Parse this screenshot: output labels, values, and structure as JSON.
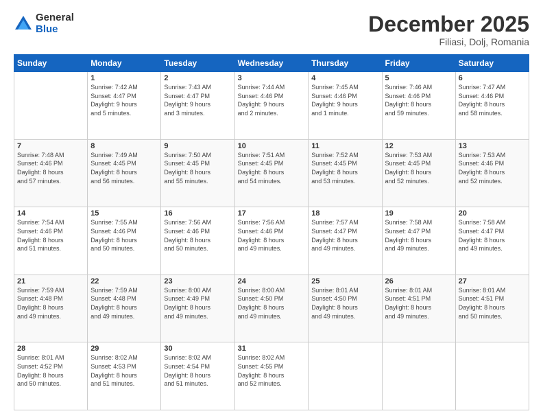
{
  "header": {
    "logo_general": "General",
    "logo_blue": "Blue",
    "month_title": "December 2025",
    "subtitle": "Filiasi, Dolj, Romania"
  },
  "days_of_week": [
    "Sunday",
    "Monday",
    "Tuesday",
    "Wednesday",
    "Thursday",
    "Friday",
    "Saturday"
  ],
  "weeks": [
    [
      {
        "day": "",
        "info": ""
      },
      {
        "day": "1",
        "info": "Sunrise: 7:42 AM\nSunset: 4:47 PM\nDaylight: 9 hours\nand 5 minutes."
      },
      {
        "day": "2",
        "info": "Sunrise: 7:43 AM\nSunset: 4:47 PM\nDaylight: 9 hours\nand 3 minutes."
      },
      {
        "day": "3",
        "info": "Sunrise: 7:44 AM\nSunset: 4:46 PM\nDaylight: 9 hours\nand 2 minutes."
      },
      {
        "day": "4",
        "info": "Sunrise: 7:45 AM\nSunset: 4:46 PM\nDaylight: 9 hours\nand 1 minute."
      },
      {
        "day": "5",
        "info": "Sunrise: 7:46 AM\nSunset: 4:46 PM\nDaylight: 8 hours\nand 59 minutes."
      },
      {
        "day": "6",
        "info": "Sunrise: 7:47 AM\nSunset: 4:46 PM\nDaylight: 8 hours\nand 58 minutes."
      }
    ],
    [
      {
        "day": "7",
        "info": "Sunrise: 7:48 AM\nSunset: 4:46 PM\nDaylight: 8 hours\nand 57 minutes."
      },
      {
        "day": "8",
        "info": "Sunrise: 7:49 AM\nSunset: 4:45 PM\nDaylight: 8 hours\nand 56 minutes."
      },
      {
        "day": "9",
        "info": "Sunrise: 7:50 AM\nSunset: 4:45 PM\nDaylight: 8 hours\nand 55 minutes."
      },
      {
        "day": "10",
        "info": "Sunrise: 7:51 AM\nSunset: 4:45 PM\nDaylight: 8 hours\nand 54 minutes."
      },
      {
        "day": "11",
        "info": "Sunrise: 7:52 AM\nSunset: 4:45 PM\nDaylight: 8 hours\nand 53 minutes."
      },
      {
        "day": "12",
        "info": "Sunrise: 7:53 AM\nSunset: 4:45 PM\nDaylight: 8 hours\nand 52 minutes."
      },
      {
        "day": "13",
        "info": "Sunrise: 7:53 AM\nSunset: 4:46 PM\nDaylight: 8 hours\nand 52 minutes."
      }
    ],
    [
      {
        "day": "14",
        "info": "Sunrise: 7:54 AM\nSunset: 4:46 PM\nDaylight: 8 hours\nand 51 minutes."
      },
      {
        "day": "15",
        "info": "Sunrise: 7:55 AM\nSunset: 4:46 PM\nDaylight: 8 hours\nand 50 minutes."
      },
      {
        "day": "16",
        "info": "Sunrise: 7:56 AM\nSunset: 4:46 PM\nDaylight: 8 hours\nand 50 minutes."
      },
      {
        "day": "17",
        "info": "Sunrise: 7:56 AM\nSunset: 4:46 PM\nDaylight: 8 hours\nand 49 minutes."
      },
      {
        "day": "18",
        "info": "Sunrise: 7:57 AM\nSunset: 4:47 PM\nDaylight: 8 hours\nand 49 minutes."
      },
      {
        "day": "19",
        "info": "Sunrise: 7:58 AM\nSunset: 4:47 PM\nDaylight: 8 hours\nand 49 minutes."
      },
      {
        "day": "20",
        "info": "Sunrise: 7:58 AM\nSunset: 4:47 PM\nDaylight: 8 hours\nand 49 minutes."
      }
    ],
    [
      {
        "day": "21",
        "info": "Sunrise: 7:59 AM\nSunset: 4:48 PM\nDaylight: 8 hours\nand 49 minutes."
      },
      {
        "day": "22",
        "info": "Sunrise: 7:59 AM\nSunset: 4:48 PM\nDaylight: 8 hours\nand 49 minutes."
      },
      {
        "day": "23",
        "info": "Sunrise: 8:00 AM\nSunset: 4:49 PM\nDaylight: 8 hours\nand 49 minutes."
      },
      {
        "day": "24",
        "info": "Sunrise: 8:00 AM\nSunset: 4:50 PM\nDaylight: 8 hours\nand 49 minutes."
      },
      {
        "day": "25",
        "info": "Sunrise: 8:01 AM\nSunset: 4:50 PM\nDaylight: 8 hours\nand 49 minutes."
      },
      {
        "day": "26",
        "info": "Sunrise: 8:01 AM\nSunset: 4:51 PM\nDaylight: 8 hours\nand 49 minutes."
      },
      {
        "day": "27",
        "info": "Sunrise: 8:01 AM\nSunset: 4:51 PM\nDaylight: 8 hours\nand 50 minutes."
      }
    ],
    [
      {
        "day": "28",
        "info": "Sunrise: 8:01 AM\nSunset: 4:52 PM\nDaylight: 8 hours\nand 50 minutes."
      },
      {
        "day": "29",
        "info": "Sunrise: 8:02 AM\nSunset: 4:53 PM\nDaylight: 8 hours\nand 51 minutes."
      },
      {
        "day": "30",
        "info": "Sunrise: 8:02 AM\nSunset: 4:54 PM\nDaylight: 8 hours\nand 51 minutes."
      },
      {
        "day": "31",
        "info": "Sunrise: 8:02 AM\nSunset: 4:55 PM\nDaylight: 8 hours\nand 52 minutes."
      },
      {
        "day": "",
        "info": ""
      },
      {
        "day": "",
        "info": ""
      },
      {
        "day": "",
        "info": ""
      }
    ]
  ]
}
